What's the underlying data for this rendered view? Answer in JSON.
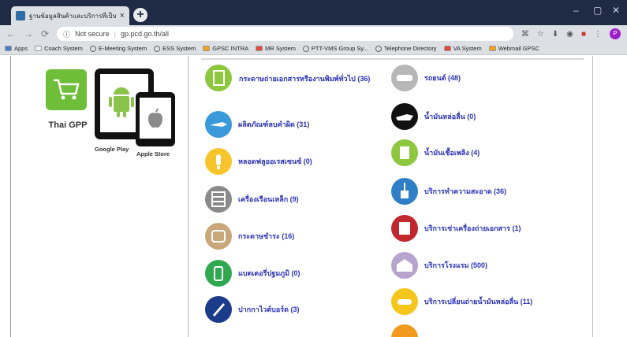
{
  "browser": {
    "tab_title": "ฐานข้อมูลสินค้าและบริการที่เป็นมิตรกั",
    "tab_close": "×",
    "new_tab": "+",
    "not_secure": "Not secure",
    "url": "gp.pcd.go.th/all",
    "window_min": "–",
    "window_max": "▢",
    "window_close": "✕",
    "avatar_letter": "P"
  },
  "bookmarks": [
    {
      "label": "Apps",
      "icon": "apps-icon",
      "color": "#4a7bd1"
    },
    {
      "label": "Coach System",
      "icon": "page-icon",
      "color": "#f2f2f2"
    },
    {
      "label": "E-Meeting System",
      "icon": "globe-icon",
      "color": ""
    },
    {
      "label": "ESS System",
      "icon": "globe-icon",
      "color": ""
    },
    {
      "label": "GPSC INTRA",
      "icon": "gpsc-icon",
      "color": "#f2a31a"
    },
    {
      "label": "MR System",
      "icon": "mr-icon",
      "color": "#e8473b"
    },
    {
      "label": "PTT-VMS Group Sy...",
      "icon": "globe-icon",
      "color": ""
    },
    {
      "label": "Telephone Directory",
      "icon": "globe-icon",
      "color": ""
    },
    {
      "label": "VA System",
      "icon": "va-icon",
      "color": "#e8473b"
    },
    {
      "label": "Webmail GPSC",
      "icon": "webmail-icon",
      "color": "#f2a31a"
    }
  ],
  "sidebar": {
    "logo_label": "Thai GPP",
    "google_play": "Google Play",
    "apple_store": "Apple Store"
  },
  "categories_left": [
    {
      "label": "กระดาษถ่ายเอกสารหรืองานพิมพ์ทั่วไป (36)",
      "icon": "paper-icon",
      "color": "#8dc63f"
    },
    {
      "label": "ผลิตภัณฑ์ลบคำผิด (31)",
      "icon": "correction-pen-icon",
      "color": "#3a9ad9"
    },
    {
      "label": "หลอดฟลูออเรสเซนซ์ (0)",
      "icon": "lightbulb-icon",
      "color": "#f7c52b"
    },
    {
      "label": "เครื่องเรือนเหล็ก (9)",
      "icon": "cabinet-icon",
      "color": "#8a8a8a"
    },
    {
      "label": "กระดาษชำระ (16)",
      "icon": "toilet-paper-icon",
      "color": "#c9a77a"
    },
    {
      "label": "แบตเตอรี่ปฐมภูมิ (0)",
      "icon": "battery-icon",
      "color": "#2fa84f"
    },
    {
      "label": "ปากกาไวต์บอร์ด (3)",
      "icon": "marker-icon",
      "color": "#1a3c8a"
    }
  ],
  "categories_right": [
    {
      "label": "รถยนต์ (48)",
      "icon": "car-icon",
      "color": "#b7b7b7"
    },
    {
      "label": "น้ำมันหล่อลื่น (0)",
      "icon": "oil-can-icon",
      "color": "#111111"
    },
    {
      "label": "น้ำมันเชื้อเพลิง (4)",
      "icon": "fuel-icon",
      "color": "#8dc63f"
    },
    {
      "label": "บริการทำความสะอาด (36)",
      "icon": "cleaning-icon",
      "color": "#2f7fc7"
    },
    {
      "label": "บริการเช่าเครื่องถ่ายเอกสาร (1)",
      "icon": "copier-icon",
      "color": "#c0282d"
    },
    {
      "label": "บริการโรงแรม (500)",
      "icon": "hotel-icon",
      "color": "#b6a4cf"
    },
    {
      "label": "บริการเปลี่ยนถ่ายน้ำมันหล่อลื่น (11)",
      "icon": "oil-change-icon",
      "color": "#f4c51a"
    },
    {
      "label": "",
      "icon": "partial-icon",
      "color": "#f29a1d"
    }
  ]
}
